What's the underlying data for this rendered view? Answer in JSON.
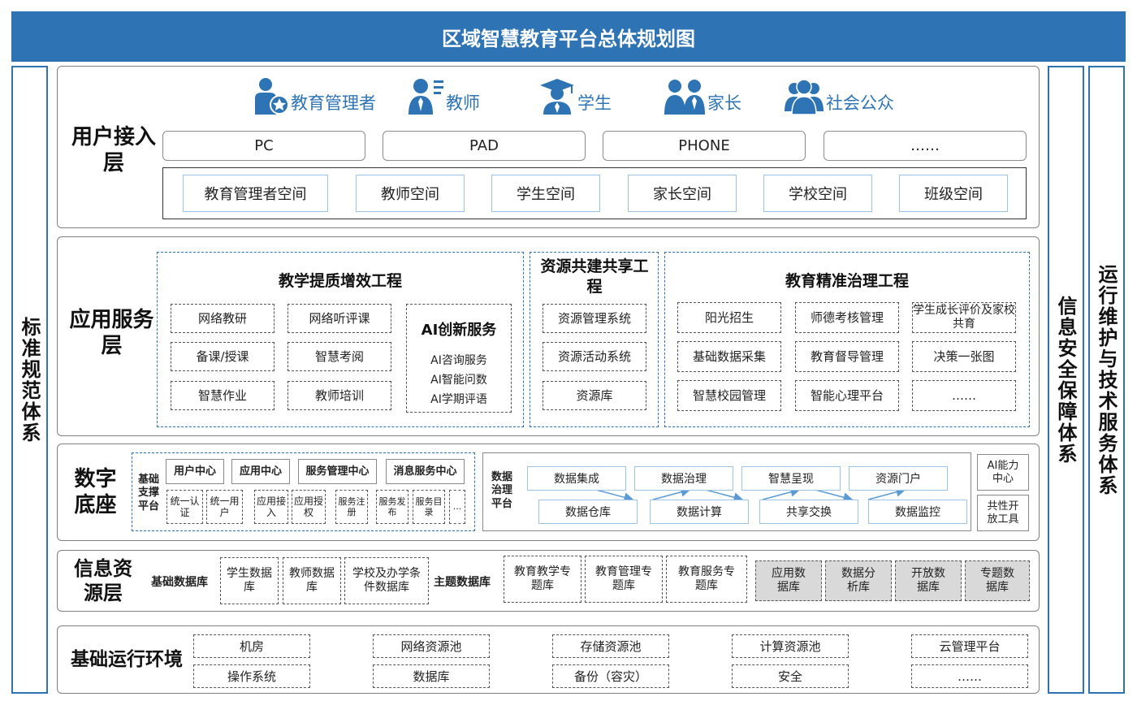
{
  "title": "区域智慧教育平台总体规划图",
  "left_side": "标准规范体系",
  "right_side_1": "信息安全保障体系",
  "right_side_2": "运行维护与技术服务体系",
  "user_layer": {
    "label": "用户接入层",
    "users": [
      {
        "label": "教育管理者",
        "icon": "administrator-icon"
      },
      {
        "label": "教师",
        "icon": "teacher-icon"
      },
      {
        "label": "学生",
        "icon": "student-icon"
      },
      {
        "label": "家长",
        "icon": "parents-icon"
      },
      {
        "label": "社会公众",
        "icon": "public-icon"
      }
    ],
    "devices": [
      "PC",
      "PAD",
      "PHONE",
      "……"
    ],
    "spaces": [
      "教育管理者空间",
      "教师空间",
      "学生空间",
      "家长空间",
      "学校空间",
      "班级空间"
    ]
  },
  "app_layer": {
    "label": "应用服务层",
    "teaching": {
      "title": "教学提质增效工程",
      "items": [
        "网络教研",
        "网络听评课",
        "备课/授课",
        "智慧考阅",
        "智慧作业",
        "教师培训"
      ],
      "ai_title": "AI创新服务",
      "ai_items": [
        "AI咨询服务",
        "AI智能问数",
        "AI学期评语"
      ]
    },
    "resource": {
      "title": "资源共建共享工程",
      "items": [
        "资源管理系统",
        "资源活动系统",
        "资源库"
      ]
    },
    "governance": {
      "title": "教育精准治理工程",
      "items": [
        "阳光招生",
        "师德考核管理",
        "学生成长评价及家校共育",
        "基础数据采集",
        "教育督导管理",
        "决策一张图",
        "智慧校园管理",
        "智能心理平台",
        "……"
      ]
    }
  },
  "digital_layer": {
    "label": "数字底座",
    "support_label": "基础支撑平台",
    "centers": [
      {
        "name": "用户中心",
        "subs": [
          "统一认证",
          "统一用户"
        ]
      },
      {
        "name": "应用中心",
        "subs": [
          "应用接入",
          "应用授权"
        ]
      },
      {
        "name": "服务管理中心",
        "subs": [
          "服务注册",
          "服务发布",
          "服务目录"
        ]
      },
      {
        "name": "消息服务中心",
        "subs": [
          "..."
        ]
      }
    ],
    "data_label": "数据治理平台",
    "data_top": [
      "数据集成",
      "数据治理",
      "智慧呈现",
      "资源门户"
    ],
    "data_bottom": [
      "数据仓库",
      "数据计算",
      "共享交换",
      "数据监控"
    ],
    "ai_center": "AI能力中心",
    "dev_tools": "共性开放工具"
  },
  "info_layer": {
    "label": "信息资源层",
    "basic_label": "基础数据库",
    "basic": [
      "学生数据库",
      "教师数据库",
      "学校及办学条件数据库"
    ],
    "topic_label": "主题数据库",
    "topic": [
      "教育教学专题库",
      "教育管理专题库",
      "教育服务专题库"
    ],
    "gray": [
      "应用数据库",
      "数据分析库",
      "开放数据库",
      "专题数据库"
    ]
  },
  "infra_layer": {
    "label": "基础运行环境",
    "top": [
      "机房",
      "网络资源池",
      "存储资源池",
      "计算资源池",
      "云管理平台"
    ],
    "bottom": [
      "操作系统",
      "数据库",
      "备份（容灾）",
      "安全",
      "……"
    ]
  },
  "colors": {
    "brand_blue": "#2e74b5",
    "light_blue": "#9dc3e6",
    "gray_fill": "#d9d9d9"
  }
}
